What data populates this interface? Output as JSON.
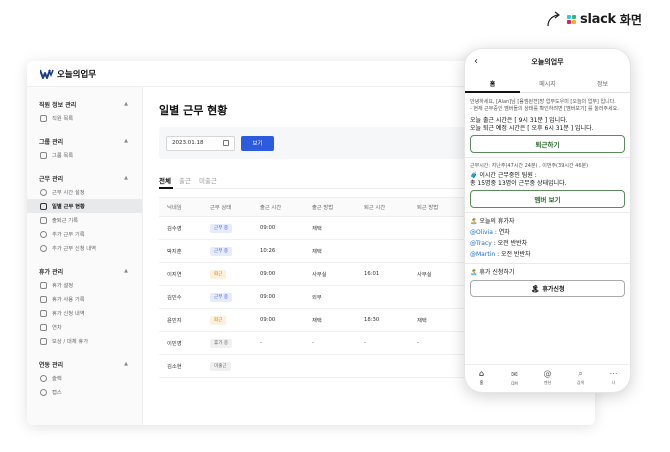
{
  "slack_badge": {
    "brand": "slack",
    "suffix": "화면",
    "logo_colors": [
      "#36c5f0",
      "#2eb67d",
      "#e01e5a",
      "#ecb22e"
    ]
  },
  "desktop": {
    "app_name": "오늘의업무",
    "sidebar": [
      {
        "title": "직원 정보 관리",
        "items": [
          {
            "label": "직원 목록",
            "icon": "person-icon"
          }
        ]
      },
      {
        "title": "그룹 관리",
        "items": [
          {
            "label": "그룹 목록",
            "icon": "group-icon"
          }
        ]
      },
      {
        "title": "근무 관리",
        "items": [
          {
            "label": "근무 시간 설정",
            "icon": "clock-icon"
          },
          {
            "label": "일별 근무 현황",
            "icon": "calendar-icon",
            "active": true
          },
          {
            "label": "출퇴근 기록",
            "icon": "walk-icon"
          },
          {
            "label": "추가 근무 기록",
            "icon": "clock-plus-icon"
          },
          {
            "label": "추가 근무 신청 내역",
            "icon": "clock-list-icon"
          }
        ]
      },
      {
        "title": "휴가 관리",
        "items": [
          {
            "label": "휴가 설정",
            "icon": "pencil-icon"
          },
          {
            "label": "휴가 사용 기록",
            "icon": "list-icon"
          },
          {
            "label": "휴가 신청 내역",
            "icon": "document-icon"
          },
          {
            "label": "연차",
            "icon": "calendar-day-icon"
          },
          {
            "label": "보상 / 대체 휴가",
            "icon": "gift-icon"
          }
        ]
      },
      {
        "title": "연동 관리",
        "items": [
          {
            "label": "슬랙",
            "icon": "link-icon"
          },
          {
            "label": "캡스",
            "icon": "shield-icon"
          }
        ]
      }
    ],
    "main": {
      "title": "일별 근무 현황",
      "date_value": "2023.01.18",
      "view_button": "보기",
      "tabs": [
        "전체",
        "출근",
        "미출근"
      ],
      "columns": [
        "닉네임",
        "근무 상태",
        "출근 시간",
        "출근 방법",
        "퇴근 시간",
        "퇴근 방법"
      ],
      "rows": [
        {
          "name": "김수영",
          "status": "근무 중",
          "status_type": "blue",
          "in_time": "09:00",
          "in_method": "재택",
          "out_time": "",
          "out_method": ""
        },
        {
          "name": "박지훈",
          "status": "근무 중",
          "status_type": "blue",
          "in_time": "10:26",
          "in_method": "재택",
          "out_time": "",
          "out_method": ""
        },
        {
          "name": "이지연",
          "status": "퇴근",
          "status_type": "orange",
          "in_time": "09:00",
          "in_method": "사무실",
          "out_time": "16:01",
          "out_method": "사무실"
        },
        {
          "name": "김민수",
          "status": "근무 중",
          "status_type": "blue",
          "in_time": "09:00",
          "in_method": "외부",
          "out_time": "",
          "out_method": ""
        },
        {
          "name": "윤민지",
          "status": "퇴근",
          "status_type": "orange",
          "in_time": "09:00",
          "in_method": "재택",
          "out_time": "18:30",
          "out_method": "재택"
        },
        {
          "name": "이민영",
          "status": "휴가 중",
          "status_type": "gray",
          "in_time": "-",
          "in_method": "-",
          "out_time": "-",
          "out_method": "-"
        },
        {
          "name": "김소현",
          "status": "미출근",
          "status_type": "gray",
          "in_time": "",
          "in_method": "",
          "out_time": "",
          "out_method": ""
        }
      ]
    }
  },
  "phone": {
    "title": "오늘의업무",
    "tabs": [
      "홈",
      "메시지",
      "정보"
    ],
    "greeting": "안녕하세요, [Alan]님 [윰엠씐젼]방 업무도우미 [오늘의 업무] 입니다.",
    "greeting2": "- 현재 근무중인 멤버들의 상태를 확인하려면 [멤버보기] 를 눌러주세요.",
    "checkin_line1": "오늘 출근 시간은 [ 9시 31분 ] 입니다.",
    "checkin_line2": "오늘 퇴근 예정 시간은 [ 오후 6시 31분 ] 입니다.",
    "checkout_button": "퇴근하기",
    "hours_info": "근무시간: 지난주(47시간 24분) , 이번주(39시간 46분)",
    "working_title": "🧳 이시간 근무중인 팀원 :",
    "working_count": "총 15명중 13명이 근무중 상태입니다.",
    "members_button": "멤버 보기",
    "vacation_title": "🏝️ 오늘의 휴가자",
    "vacationers": [
      {
        "mention": "@Olivia",
        "text": " : 연차"
      },
      {
        "mention": "@Tracy",
        "text": " : 오전 반반차"
      },
      {
        "mention": "@Martin",
        "text": " : 오전 반반차"
      }
    ],
    "request_title": "🏝️ 휴가 신청하기",
    "request_button": "휴가신청",
    "nav": [
      {
        "label": "홈",
        "icon": "home-icon",
        "glyph": "⌂"
      },
      {
        "label": "DM",
        "icon": "dm-icon",
        "glyph": "✉"
      },
      {
        "label": "멘션",
        "icon": "mention-icon",
        "glyph": "@"
      },
      {
        "label": "검색",
        "icon": "search-icon",
        "glyph": "⌕"
      },
      {
        "label": "나",
        "icon": "more-icon",
        "glyph": "⋯"
      }
    ]
  }
}
